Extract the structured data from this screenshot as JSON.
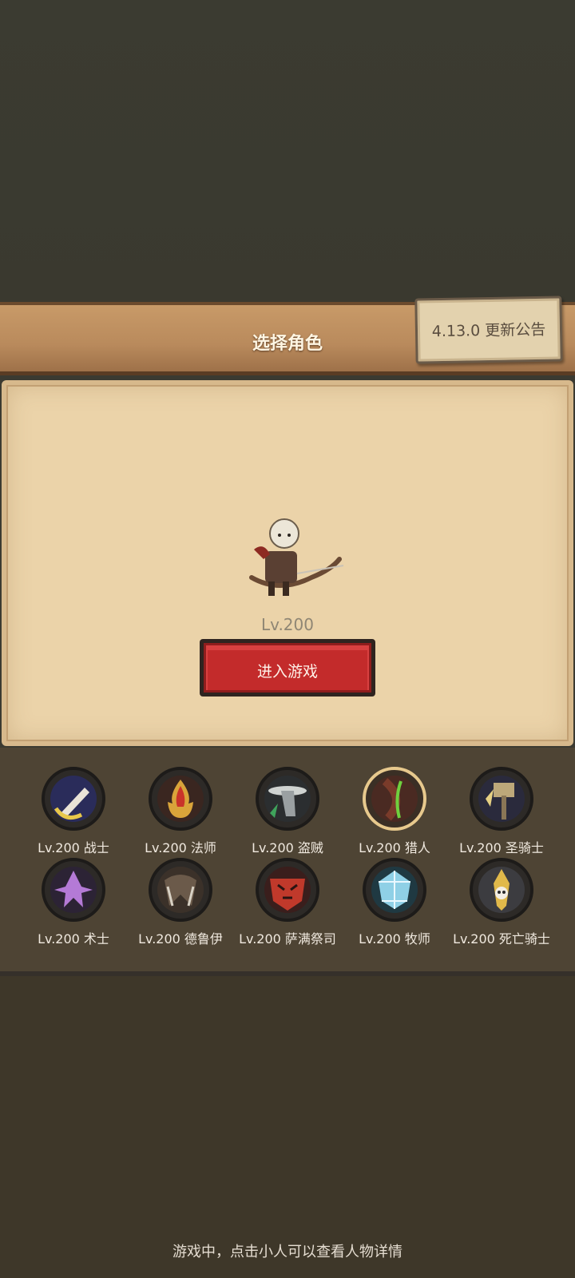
{
  "header": {
    "title": "选择角色"
  },
  "notice_button": {
    "label": "4.13.0 更新公告"
  },
  "selected_character": {
    "level": "Lv.200",
    "enter_label": "进入游戏"
  },
  "classes": [
    {
      "label": "Lv.200 战士",
      "icon": "warrior-sword-icon",
      "color": "#e9e3d7"
    },
    {
      "label": "Lv.200 法师",
      "icon": "mage-flame-icon",
      "color": "#c9342a"
    },
    {
      "label": "Lv.200 盗贼",
      "icon": "rogue-hat-icon",
      "color": "#cfd3d1"
    },
    {
      "label": "Lv.200 猎人",
      "icon": "hunter-bow-icon",
      "color": "#7a3b2a",
      "selected": true
    },
    {
      "label": "Lv.200 圣骑士",
      "icon": "paladin-hammer-icon",
      "color": "#bda87a"
    },
    {
      "label": "Lv.200 术士",
      "icon": "warlock-hat-icon",
      "color": "#b47ad6"
    },
    {
      "label": "Lv.200 德鲁伊",
      "icon": "druid-claw-icon",
      "color": "#6b5a4a"
    },
    {
      "label": "Lv.200 萨满祭司",
      "icon": "shaman-totem-icon",
      "color": "#c0392b"
    },
    {
      "label": "Lv.200 牧师",
      "icon": "priest-crystal-icon",
      "color": "#8fd0e6"
    },
    {
      "label": "Lv.200 死亡骑士",
      "icon": "death-knight-skull-icon",
      "color": "#e1b94a"
    }
  ],
  "footer": {
    "hint": "游戏中，点击小人可以查看人物详情"
  }
}
